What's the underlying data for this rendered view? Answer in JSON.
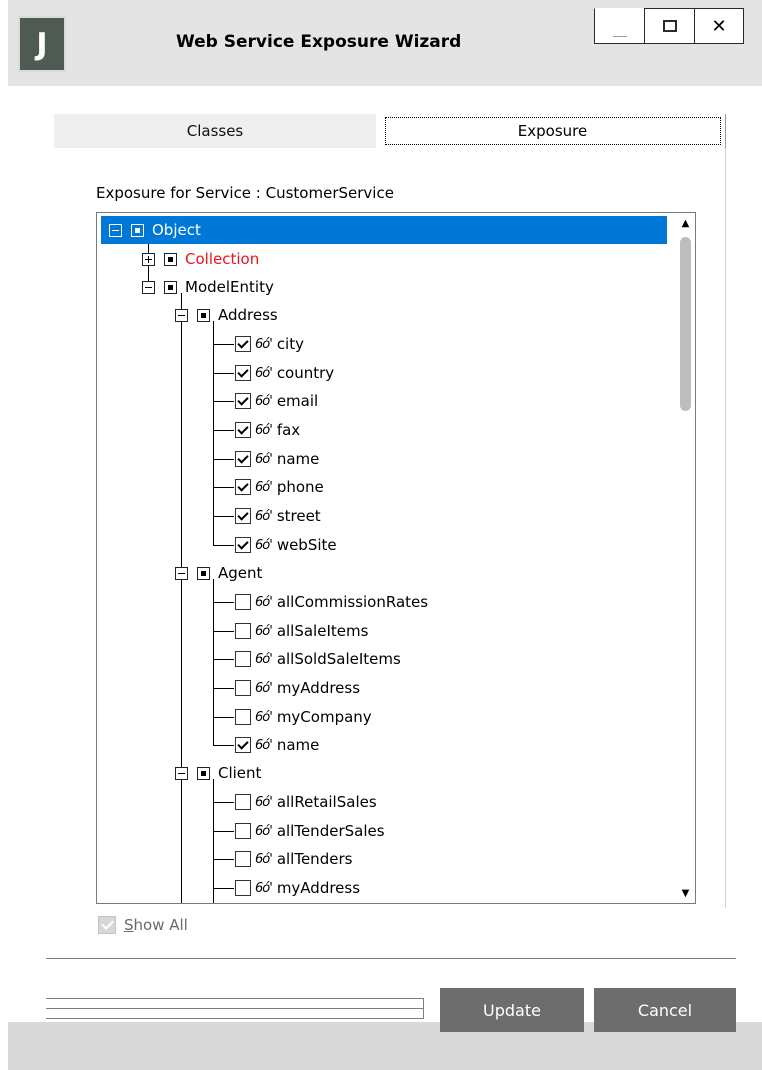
{
  "window": {
    "logo": "J",
    "title": "Web Service Exposure Wizard",
    "minimize": "_",
    "maximize": "□",
    "close": "✕"
  },
  "tabs": [
    {
      "label": "Classes",
      "active": false
    },
    {
      "label": "Exposure",
      "active": true
    }
  ],
  "exposure_label": "Exposure for Service : CustomerService",
  "tree": {
    "root": "Object",
    "collection": "Collection",
    "model_entity": "ModelEntity",
    "address": {
      "label": "Address",
      "fields": [
        {
          "name": "city",
          "checked": true
        },
        {
          "name": "country",
          "checked": true
        },
        {
          "name": "email",
          "checked": true
        },
        {
          "name": "fax",
          "checked": true
        },
        {
          "name": "name",
          "checked": true
        },
        {
          "name": "phone",
          "checked": true
        },
        {
          "name": "street",
          "checked": true
        },
        {
          "name": "webSite",
          "checked": true
        }
      ]
    },
    "agent": {
      "label": "Agent",
      "fields": [
        {
          "name": "allCommissionRates",
          "checked": false
        },
        {
          "name": "allSaleItems",
          "checked": false
        },
        {
          "name": "allSoldSaleItems",
          "checked": false
        },
        {
          "name": "myAddress",
          "checked": false
        },
        {
          "name": "myCompany",
          "checked": false
        },
        {
          "name": "name",
          "checked": true
        }
      ]
    },
    "client": {
      "label": "Client",
      "fields": [
        {
          "name": "allRetailSales",
          "checked": false
        },
        {
          "name": "allTenderSales",
          "checked": false
        },
        {
          "name": "allTenders",
          "checked": false
        },
        {
          "name": "myAddress",
          "checked": false
        }
      ]
    },
    "glasses_glyph": "6ó'"
  },
  "show_all": {
    "label": "Show All",
    "checked": true,
    "enabled": false
  },
  "buttons": {
    "update": "Update",
    "cancel": "Cancel"
  },
  "colors": {
    "selection": "#0078d7",
    "button": "#6d6d6d",
    "collection_text": "#e8141f"
  }
}
